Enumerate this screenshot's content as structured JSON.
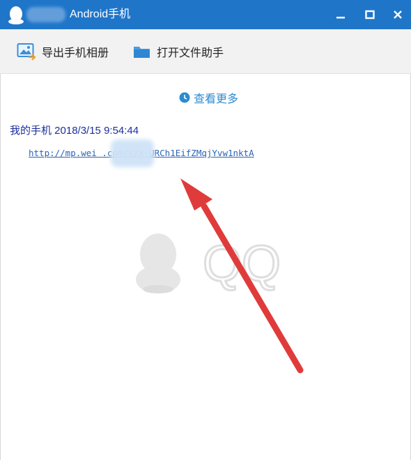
{
  "window": {
    "title": "Android手机",
    "minimize_icon": "minimize-icon",
    "maximize_icon": "maximize-icon",
    "close_icon": "close-icon"
  },
  "toolbar": {
    "items": [
      {
        "label": "导出手机相册",
        "icon": "photo-album-export-icon"
      },
      {
        "label": "打开文件助手",
        "icon": "folder-icon"
      }
    ]
  },
  "chat": {
    "view_more": "查看更多",
    "view_more_icon": "clock-icon",
    "message": {
      "sender_time": "我的手机 2018/3/15 9:54:44",
      "link": "http://mp.wei    .com/s/x-URCh1EifZMqjYvw1nktA"
    },
    "watermark_text": "QQ"
  },
  "colors": {
    "titlebar": "#1f76c9",
    "toolbar_bg": "#f2f2f2",
    "link": "#2a64b5",
    "view_more": "#2b8bd0",
    "sender": "#1b2f9c",
    "arrow": "#e03b3b"
  }
}
